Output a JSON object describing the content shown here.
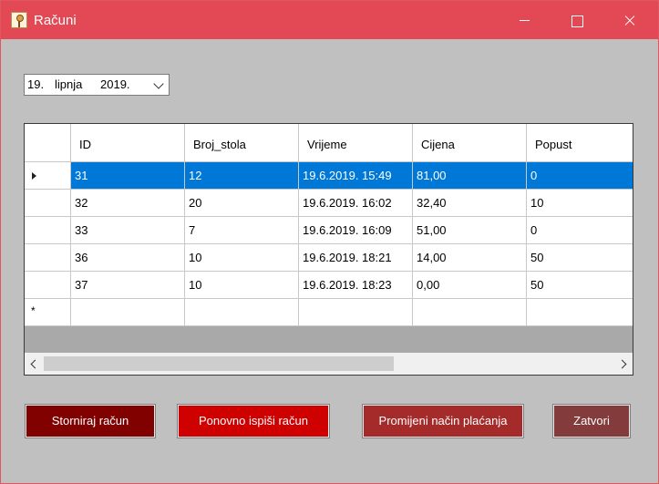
{
  "window": {
    "title": "Računi"
  },
  "date_filter": {
    "day": "19.",
    "month": "lipnja",
    "year": "2019."
  },
  "grid": {
    "columns": [
      "ID",
      "Broj_stola",
      "Vrijeme",
      "Cijena",
      "Popust"
    ],
    "rows": [
      [
        "31",
        "12",
        "19.6.2019. 15:49",
        "81,00",
        "0"
      ],
      [
        "32",
        "20",
        "19.6.2019. 16:02",
        "32,40",
        "10"
      ],
      [
        "33",
        "7",
        "19.6.2019. 16:09",
        "51,00",
        "0"
      ],
      [
        "36",
        "10",
        "19.6.2019. 18:21",
        "14,00",
        "50"
      ],
      [
        "37",
        "10",
        "19.6.2019. 18:23",
        "0,00",
        "50"
      ]
    ],
    "new_row_marker": "*"
  },
  "buttons": {
    "storno": "Storniraj račun",
    "reprint": "Ponovno ispiši račun",
    "change_payment": "Promijeni način plaćanja",
    "close": "Zatvori"
  },
  "colors": {
    "titlebar": "#e34954",
    "selection": "#0078d7",
    "btn_storno": "#810000",
    "btn_reprint": "#cf0000",
    "btn_payment": "#a52a2a",
    "btn_close": "#833b3b"
  }
}
